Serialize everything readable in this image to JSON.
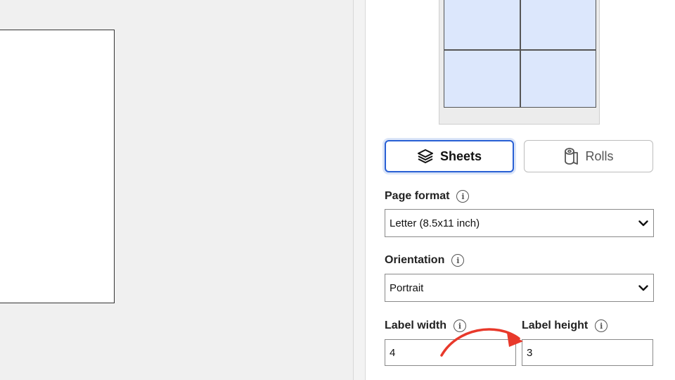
{
  "mode_buttons": {
    "sheets": {
      "label": "Sheets",
      "icon": "layers-icon",
      "selected": true
    },
    "rolls": {
      "label": "Rolls",
      "icon": "label-roll-icon",
      "selected": false
    }
  },
  "page_format": {
    "label": "Page format",
    "value": "Letter (8.5x11 inch)"
  },
  "orientation": {
    "label": "Orientation",
    "value": "Portrait"
  },
  "label_width": {
    "label": "Label width",
    "value": "4"
  },
  "label_height": {
    "label": "Label height",
    "value": "3"
  },
  "info_icon_glyph": "i",
  "colors": {
    "accent": "#2960d4",
    "preview_cell": "#dce7fc",
    "annotation": "#e8392b"
  }
}
